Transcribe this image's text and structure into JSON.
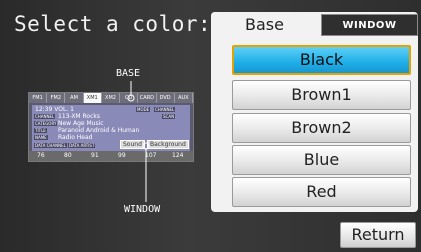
{
  "title": "Select a color:",
  "callouts": {
    "base": "BASE",
    "window": "WINDOW"
  },
  "preview": {
    "tabs": [
      "FM1",
      "FM2",
      "AM",
      "XM1",
      "XM2",
      "CD",
      "CARD",
      "DVD",
      "AUX"
    ],
    "active_tab": "XM1",
    "clock": "12:39",
    "vol": "VOL. 1",
    "lines": [
      "113-XM Rocks",
      "New Age Music",
      "Paranoid Android & Human",
      "Radio Head"
    ],
    "chips": [
      "CHANNEL",
      "CATEGORY",
      "TITLE",
      "NAME",
      "MODE",
      "CHANNEL",
      "SCAN"
    ],
    "left_chips": [
      "DATA CHANNEL",
      "DATA ARTIST"
    ],
    "buttons": [
      "Sound",
      "Background"
    ],
    "presets": [
      "76",
      "80",
      "91",
      "99",
      "107",
      "124"
    ]
  },
  "tabs": {
    "base": "Base",
    "window": "WINDOW"
  },
  "colors": [
    "Black",
    "Brown1",
    "Brown2",
    "Blue",
    "Red"
  ],
  "selected_color": "Black",
  "return_label": "Return"
}
